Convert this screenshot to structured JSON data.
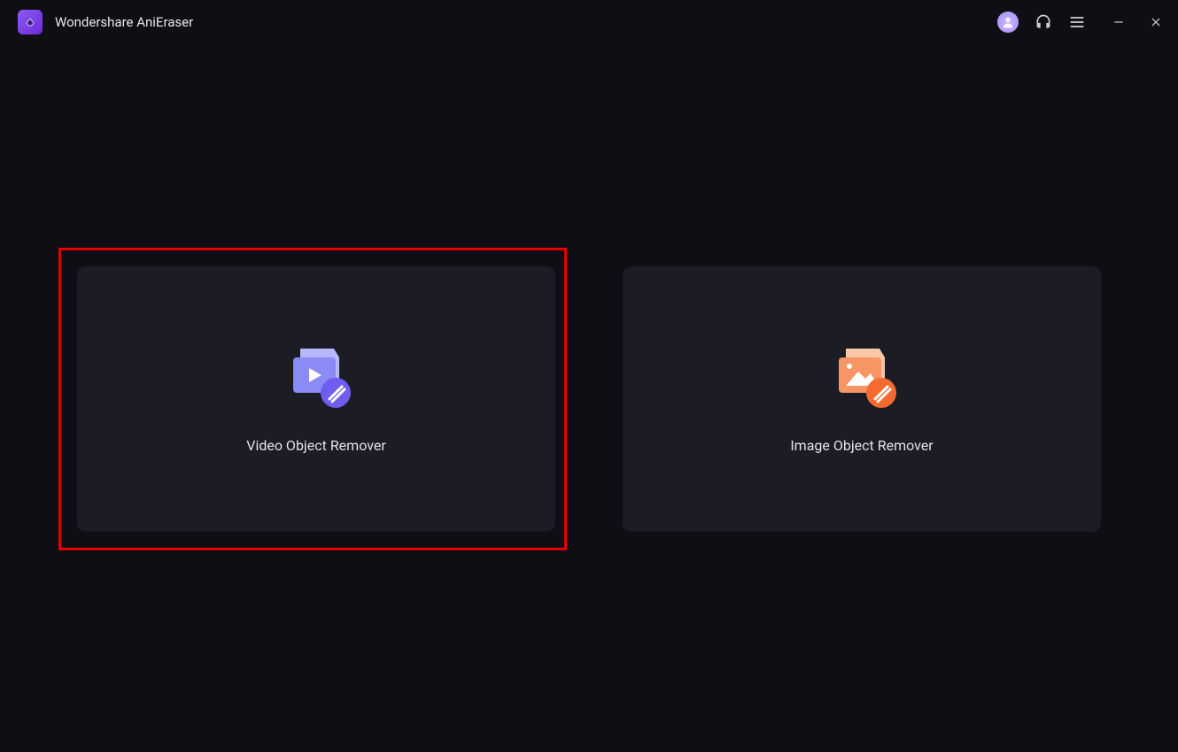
{
  "app": {
    "title": "Wondershare AniEraser"
  },
  "cards": {
    "video": {
      "label": "Video Object Remover"
    },
    "image": {
      "label": "Image Object Remover"
    }
  },
  "icons": {
    "logo": "app-logo",
    "avatar": "user-avatar",
    "support": "headset",
    "menu": "hamburger",
    "minimize": "minimize",
    "close": "close"
  },
  "colors": {
    "videoPrimary": "#8b8bf5",
    "videoBadge": "#6d5ef0",
    "imagePrimary": "#f79563",
    "imageBadge": "#f46a2f",
    "highlight": "#e30202",
    "cardBg": "#1c1c24",
    "bg": "#0e0e14"
  }
}
